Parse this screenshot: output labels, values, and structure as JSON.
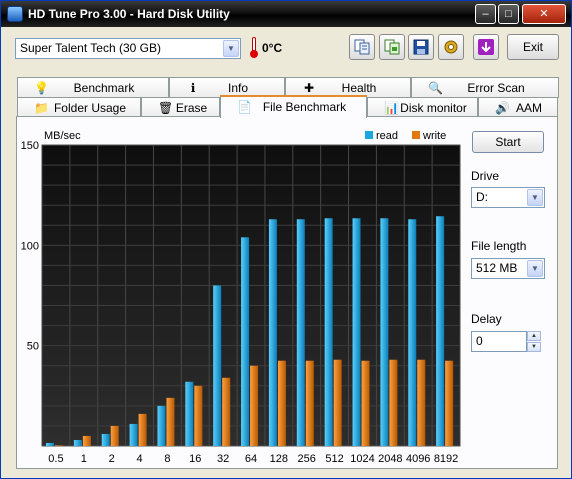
{
  "window": {
    "title": "HD Tune Pro 3.00 - Hard Disk Utility",
    "controls": {
      "minimize": "–",
      "maximize": "□",
      "close": "✕"
    }
  },
  "toolbar": {
    "disk": "Super Talent Tech (30 GB)",
    "temperature": "0°C",
    "exit_label": "Exit",
    "icons": [
      "copy-text-icon",
      "copy-screenshot-icon",
      "save-icon",
      "options-icon",
      "download-icon"
    ]
  },
  "tabs": {
    "row1": [
      {
        "label": "Benchmark",
        "icon": "benchmark-bulb-icon",
        "glyph": "💡"
      },
      {
        "label": "Info",
        "icon": "info-icon",
        "glyph": "ℹ"
      },
      {
        "label": "Health",
        "icon": "health-cross-icon",
        "glyph": "✚"
      },
      {
        "label": "Error Scan",
        "icon": "magnifier-icon",
        "glyph": "🔍"
      }
    ],
    "row2": [
      {
        "label": "Folder Usage",
        "icon": "folder-icon",
        "glyph": "📁"
      },
      {
        "label": "Erase",
        "icon": "trash-icon",
        "glyph": "🗑"
      },
      {
        "label": "File Benchmark",
        "icon": "file-icon",
        "glyph": "📄",
        "active": true
      },
      {
        "label": "Disk monitor",
        "icon": "monitor-chart-icon",
        "glyph": "📊"
      },
      {
        "label": "AAM",
        "icon": "speaker-icon",
        "glyph": "🔊"
      }
    ]
  },
  "controls": {
    "start_label": "Start",
    "drive_label": "Drive",
    "drive_value": "D:",
    "file_length_label": "File length",
    "file_length_value": "512 MB",
    "delay_label": "Delay",
    "delay_value": "0"
  },
  "chart_data": {
    "type": "bar",
    "ylabel": "MB/sec",
    "ylim": [
      0,
      150
    ],
    "yticks": [
      50,
      100,
      150
    ],
    "categories": [
      "0.5",
      "1",
      "2",
      "4",
      "8",
      "16",
      "32",
      "64",
      "128",
      "256",
      "512",
      "1024",
      "2048",
      "4096",
      "8192"
    ],
    "series": [
      {
        "name": "read",
        "color": "#1aa7e0",
        "values": [
          1.5,
          3,
          6,
          11,
          20,
          32,
          80,
          104,
          113,
          113,
          113.5,
          113.5,
          113.5,
          113,
          114.5
        ]
      },
      {
        "name": "write",
        "color": "#e07a10",
        "values": [
          0.3,
          5,
          10,
          16,
          24,
          30,
          34,
          40,
          42.5,
          42.5,
          43,
          42.5,
          43,
          43,
          42.5
        ]
      }
    ],
    "grid": true,
    "legend": "top-right",
    "background": "#1a1a1a"
  }
}
